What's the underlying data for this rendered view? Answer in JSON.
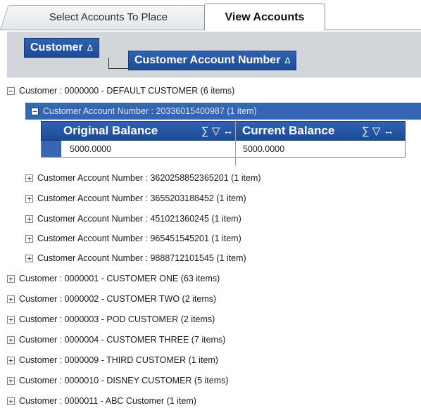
{
  "tabs": [
    {
      "label": "Select Accounts To Place",
      "active": false
    },
    {
      "label": "View Accounts",
      "active": true
    }
  ],
  "group_by": {
    "level1": {
      "label": "Customer",
      "sort_glyph": "Δ"
    },
    "level2": {
      "label": "Customer Account Number",
      "sort_glyph": "Δ"
    }
  },
  "expanded_customer": {
    "label": "Customer : 0000000 - DEFAULT CUSTOMER (6 items)",
    "expanded_account": {
      "label": "Customer Account Number : 20336015400987 (1 item)"
    },
    "detail_grid": {
      "columns": [
        {
          "label": "Original Balance",
          "icons": "∑ ▽ ↔"
        },
        {
          "label": "Current Balance",
          "icons": "∑ ▽ ↔"
        }
      ],
      "rows": [
        [
          "5000.0000",
          "5000.0000"
        ]
      ]
    },
    "collapsed_accounts": [
      "Customer Account Number : 3620258852365201 (1 item)",
      "Customer Account Number : 3655203188452 (1 item)",
      "Customer Account Number : 451021360245 (1 item)",
      "Customer Account Number : 965451545201 (1 item)",
      "Customer Account Number : 9888712101545 (1 item)"
    ]
  },
  "collapsed_customers": [
    "Customer : 0000001 - CUSTOMER ONE (63 items)",
    "Customer : 0000002 - CUSTOMER TWO (2 items)",
    "Customer : 0000003 - POD CUSTOMER (2 items)",
    "Customer : 0000004 - CUSTOMER THREE (7 items)",
    "Customer : 0000009 - THIRD CUSTOMER (1 item)",
    "Customer : 0000010 - DISNEY CUSTOMER (5 items)",
    "Customer : 0000011 - ABC Customer (1 item)"
  ],
  "icons": {
    "expand": "plus-box-icon",
    "collapse": "minus-box-icon"
  },
  "colors": {
    "header_blue": "#2f62b0",
    "selection_blue": "#3565b3",
    "groupbar_gray": "#d2d5da"
  }
}
